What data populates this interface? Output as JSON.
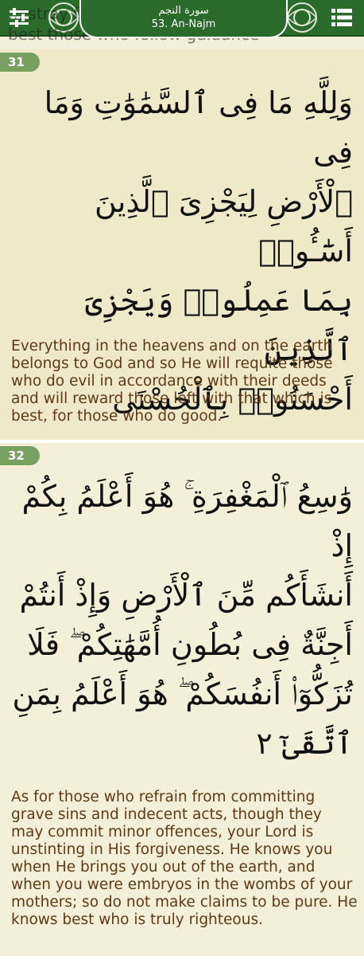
{
  "header": {
    "surah_arabic": "سورة النجم",
    "surah_english": "53. An-Najm",
    "bleed_line1": "... stray from the path and ...",
    "bleed_line2": "best those who follow guidance"
  },
  "icons": {
    "left": "sliders-icon",
    "right": "list-menu-icon"
  },
  "colors": {
    "topbar": "#2a6a2a",
    "verse_badge": "#78a060",
    "translation_text": "#5c3a16",
    "page_background": "#f3efd9"
  },
  "verses": [
    {
      "number": "31",
      "arabic_lines": [
        "وَلِلَّهِ مَا فِى ٱلسَّمَٰوَٰتِ وَمَا فِى",
        "ٱلْأَرْضِ لِيَجْزِىَ ٱلَّذِينَ أَسَٰٓـُٔوا۟",
        "بِمَا عَمِلُوا۟ وَيَجْزِىَ ٱلَّذِينَ",
        "أَحْسَنُوا۟ بِٱلْحُسْنَى"
      ],
      "translation": "Everything in the heavens and on the earth belongs to God and so He will requite those who do evil in accordance with their deeds and will reward those left with that which is best, for those who do good."
    },
    {
      "number": "32",
      "arabic_lines": [
        "وَٰسِعُ ٱلْمَغْفِرَةِ ۚ هُوَ أَعْلَمُ بِكُمْ إِذْ",
        "أَنشَأَكُم مِّنَ ٱلْأَرْضِ وَإِذْ أَنتُمْ",
        "أَجِنَّةٌ فِى بُطُونِ أُمَّهَٰتِكُمْ ۖ فَلَا",
        "تُزَكُّوٓا۟ أَنفُسَكُمْ ۖ هُوَ أَعْلَمُ بِمَنِ",
        "ٱتَّقَىٰٓ ٢"
      ],
      "translation": "As for those who refrain from committing grave sins and indecent acts, though they may commit minor offences, your Lord is unstinting in His forgiveness. He knows you when He brings you out of the earth, and when you were embryos in the wombs of your mothers; so do not make claims to be pure. He knows best who is truly righteous."
    }
  ]
}
